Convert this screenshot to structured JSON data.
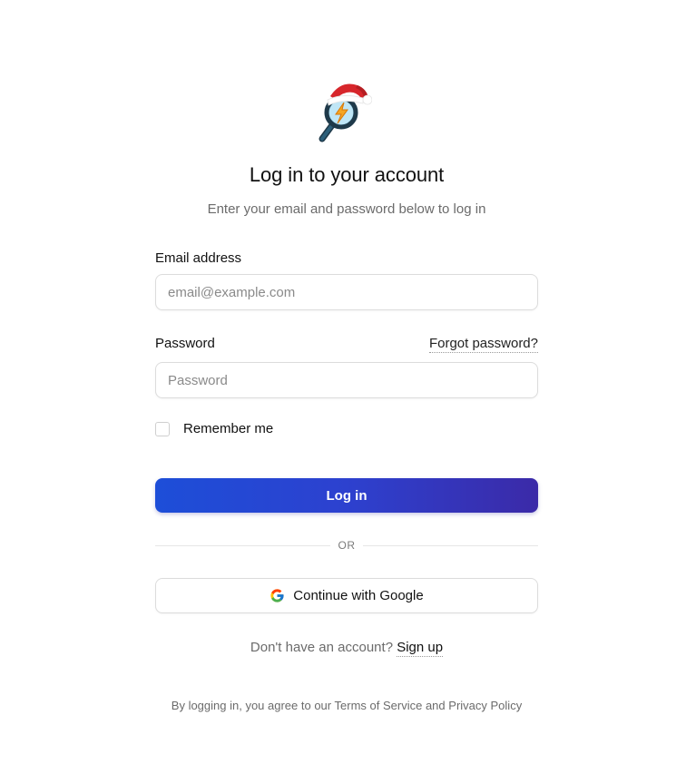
{
  "header": {
    "title": "Log in to your account",
    "subtitle": "Enter your email and password below to log in"
  },
  "form": {
    "email_label": "Email address",
    "email_value": "",
    "email_placeholder": "email@example.com",
    "password_label": "Password",
    "password_value": "",
    "password_placeholder": "Password",
    "forgot_password": "Forgot password?",
    "remember_me": "Remember me",
    "remember_checked": false,
    "login_button": "Log in"
  },
  "divider": {
    "text": "OR"
  },
  "oauth": {
    "google_button": "Continue with Google",
    "google_icon": "google-g-icon"
  },
  "signup": {
    "prompt": "Don't have an account?",
    "link": "Sign up"
  },
  "legal": {
    "prefix": "By logging in, you agree to our",
    "terms": "Terms of Service",
    "and": "and",
    "privacy": "Privacy Policy"
  },
  "logo": {
    "icon": "magnifier-lightning-santa-hat-icon"
  },
  "colors": {
    "primary_start": "#1d4ed8",
    "primary_end": "#3b2aa8",
    "muted_text": "#6b6b6b",
    "border": "#dcdcdc"
  }
}
